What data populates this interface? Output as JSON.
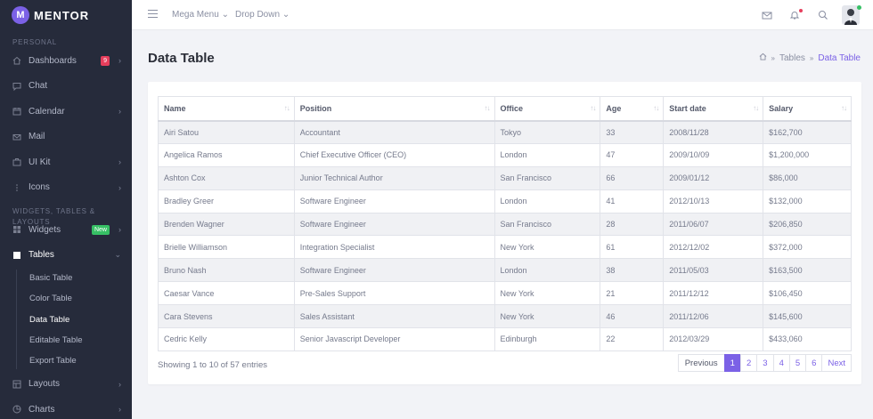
{
  "brand": {
    "logo_letter": "M",
    "name": "MENTOR"
  },
  "sidebar": {
    "heading_personal": "PERSONAL",
    "heading_widgets": "WIDGETS, TABLES & LAYOUTS",
    "items": [
      {
        "label": "Dashboards",
        "icon": "home-icon",
        "badge": "9"
      },
      {
        "label": "Chat",
        "icon": "chat-icon"
      },
      {
        "label": "Calendar",
        "icon": "calendar-icon"
      },
      {
        "label": "Mail",
        "icon": "mail-icon"
      },
      {
        "label": "UI Kit",
        "icon": "briefcase-icon"
      },
      {
        "label": "Icons",
        "icon": "more-vertical-icon"
      },
      {
        "label": "Widgets",
        "icon": "grid-icon",
        "badge": "New"
      },
      {
        "label": "Tables",
        "icon": "table-icon"
      },
      {
        "label": "Layouts",
        "icon": "layout-icon"
      },
      {
        "label": "Charts",
        "icon": "pie-chart-icon"
      }
    ],
    "tables_sub": [
      "Basic Table",
      "Color Table",
      "Data Table",
      "Editable Table",
      "Export Table"
    ]
  },
  "topbar": {
    "mega_menu": "Mega Menu",
    "drop_down": "Drop Down"
  },
  "page": {
    "title": "Data Table",
    "breadcrumb": [
      "Tables",
      "Data Table"
    ]
  },
  "table": {
    "columns": [
      "Name",
      "Position",
      "Office",
      "Age",
      "Start date",
      "Salary"
    ],
    "rows": [
      [
        "Airi Satou",
        "Accountant",
        "Tokyo",
        "33",
        "2008/11/28",
        "$162,700"
      ],
      [
        "Angelica Ramos",
        "Chief Executive Officer (CEO)",
        "London",
        "47",
        "2009/10/09",
        "$1,200,000"
      ],
      [
        "Ashton Cox",
        "Junior Technical Author",
        "San Francisco",
        "66",
        "2009/01/12",
        "$86,000"
      ],
      [
        "Bradley Greer",
        "Software Engineer",
        "London",
        "41",
        "2012/10/13",
        "$132,000"
      ],
      [
        "Brenden Wagner",
        "Software Engineer",
        "San Francisco",
        "28",
        "2011/06/07",
        "$206,850"
      ],
      [
        "Brielle Williamson",
        "Integration Specialist",
        "New York",
        "61",
        "2012/12/02",
        "$372,000"
      ],
      [
        "Bruno Nash",
        "Software Engineer",
        "London",
        "38",
        "2011/05/03",
        "$163,500"
      ],
      [
        "Caesar Vance",
        "Pre-Sales Support",
        "New York",
        "21",
        "2011/12/12",
        "$106,450"
      ],
      [
        "Cara Stevens",
        "Sales Assistant",
        "New York",
        "46",
        "2011/12/06",
        "$145,600"
      ],
      [
        "Cedric Kelly",
        "Senior Javascript Developer",
        "Edinburgh",
        "22",
        "2012/03/29",
        "$433,060"
      ]
    ],
    "info": "Showing 1 to 10 of 57 entries",
    "pagination": {
      "previous": "Previous",
      "pages": [
        "1",
        "2",
        "3",
        "4",
        "5",
        "6"
      ],
      "next": "Next",
      "active": "1"
    }
  },
  "colors": {
    "accent": "#7b61e6",
    "sidebar_bg": "#262b3b",
    "badge_red": "#e63e5c",
    "badge_green": "#37c065"
  }
}
